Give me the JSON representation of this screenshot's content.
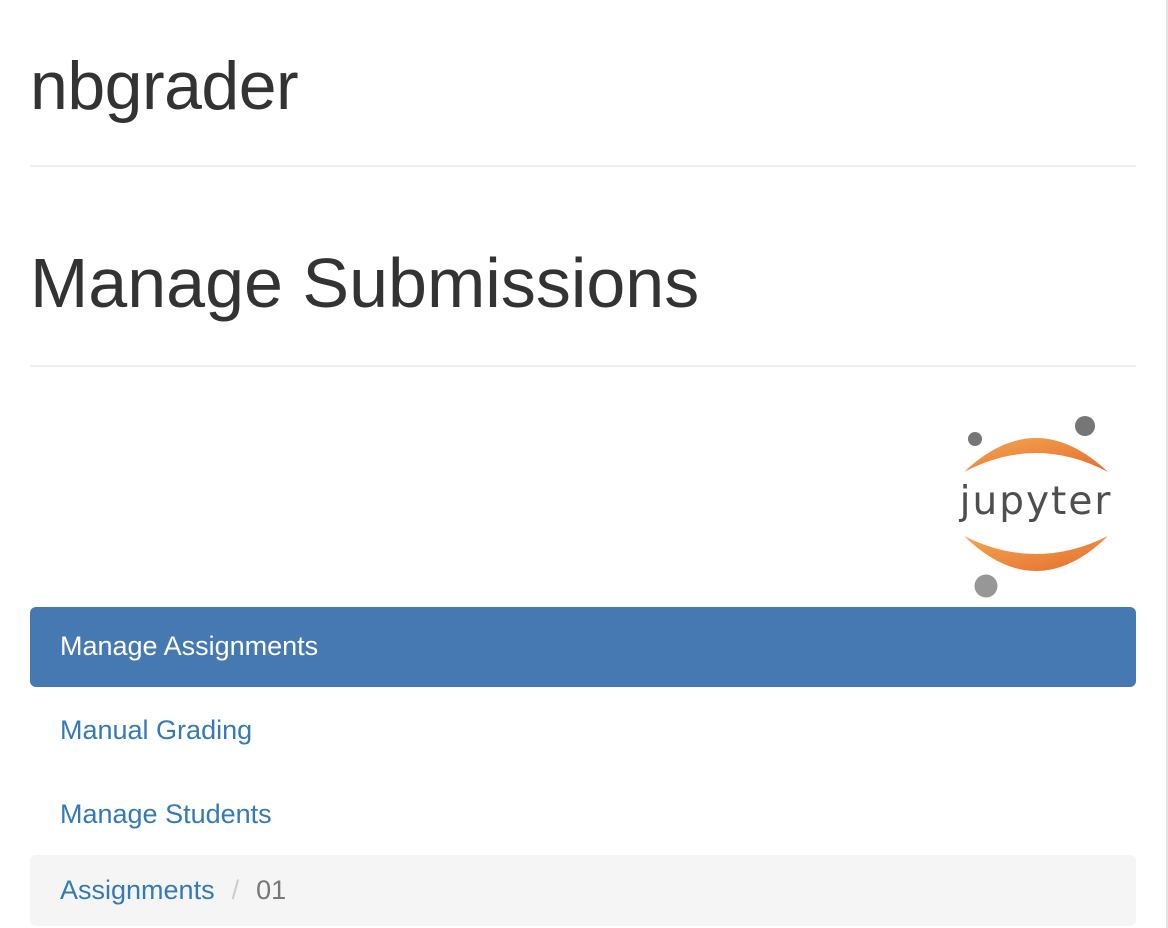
{
  "header": {
    "app_title": "nbgrader",
    "page_title": "Manage Submissions"
  },
  "logo": {
    "icon": "jupyter-logo-icon",
    "wordmark": "jupyter",
    "colors": {
      "orange_light": "#f5a552",
      "orange_dark": "#e46e2e",
      "gray": "#767677",
      "text": "#4e4e4e"
    }
  },
  "nav": {
    "items": [
      {
        "label": "Manage Assignments",
        "active": true
      },
      {
        "label": "Manual Grading",
        "active": false
      },
      {
        "label": "Manage Students",
        "active": false
      }
    ]
  },
  "breadcrumb": {
    "root": "Assignments",
    "separator": "/",
    "current": "01"
  },
  "colors": {
    "accent": "#4679b2",
    "link": "#337ab7",
    "breadcrumb_bg": "#f5f5f5"
  }
}
